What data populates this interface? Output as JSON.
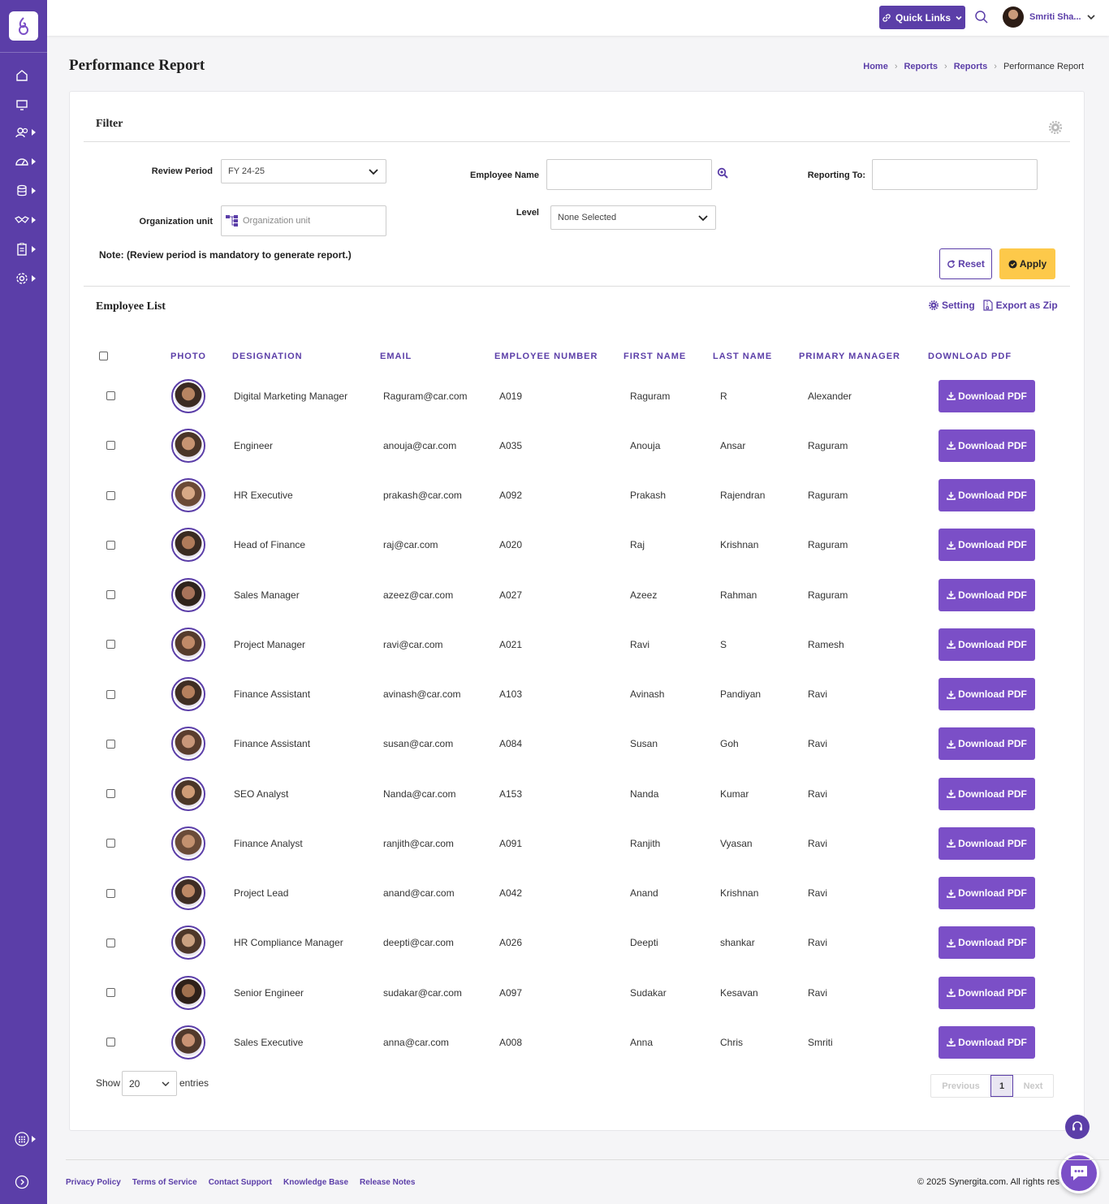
{
  "colors": {
    "brand": "#5b3ea8",
    "download": "#7b4fc7",
    "apply": "#fdc94a"
  },
  "topbar": {
    "quick_links": "Quick Links",
    "user_name": "Smriti Sha..."
  },
  "header": {
    "title": "Performance Report",
    "breadcrumb": [
      "Home",
      "Reports",
      "Reports",
      "Performance Report"
    ]
  },
  "filter": {
    "title": "Filter",
    "review_period_label": "Review Period",
    "review_period_value": "FY 24-25",
    "employee_name_label": "Employee Name",
    "employee_name_value": "",
    "reporting_to_label": "Reporting To:",
    "reporting_to_value": "",
    "org_unit_label": "Organization unit",
    "org_unit_placeholder": "Organization unit",
    "level_label": "Level",
    "level_value": "None Selected",
    "note": "Note: (Review period is mandatory to generate report.)",
    "reset": "Reset",
    "apply": "Apply"
  },
  "employee_list": {
    "title": "Employee List",
    "setting": "Setting",
    "export": "Export as Zip",
    "columns": [
      "PHOTO",
      "DESIGNATION",
      "EMAIL",
      "EMPLOYEE NUMBER",
      "FIRST NAME",
      "LAST NAME",
      "PRIMARY MANAGER",
      "DOWNLOAD PDF"
    ],
    "download_label": "Download PDF",
    "rows": [
      {
        "designation": "Digital Marketing Manager",
        "email": "Raguram@car.com",
        "number": "A019",
        "first": "Raguram",
        "last": "R",
        "manager": "Alexander"
      },
      {
        "designation": "Engineer",
        "email": "anouja@car.com",
        "number": "A035",
        "first": "Anouja",
        "last": "Ansar",
        "manager": "Raguram"
      },
      {
        "designation": "HR Executive",
        "email": "prakash@car.com",
        "number": "A092",
        "first": "Prakash",
        "last": "Rajendran",
        "manager": "Raguram"
      },
      {
        "designation": "Head of Finance",
        "email": "raj@car.com",
        "number": "A020",
        "first": "Raj",
        "last": "Krishnan",
        "manager": "Raguram"
      },
      {
        "designation": "Sales Manager",
        "email": "azeez@car.com",
        "number": "A027",
        "first": "Azeez",
        "last": "Rahman",
        "manager": "Raguram"
      },
      {
        "designation": "Project Manager",
        "email": "ravi@car.com",
        "number": "A021",
        "first": "Ravi",
        "last": "S",
        "manager": "Ramesh"
      },
      {
        "designation": "Finance Assistant",
        "email": "avinash@car.com",
        "number": "A103",
        "first": "Avinash",
        "last": "Pandiyan",
        "manager": "Ravi"
      },
      {
        "designation": "Finance Assistant",
        "email": "susan@car.com",
        "number": "A084",
        "first": "Susan",
        "last": "Goh",
        "manager": "Ravi"
      },
      {
        "designation": "SEO Analyst",
        "email": "Nanda@car.com",
        "number": "A153",
        "first": "Nanda",
        "last": "Kumar",
        "manager": "Ravi"
      },
      {
        "designation": "Finance Analyst",
        "email": "ranjith@car.com",
        "number": "A091",
        "first": "Ranjith",
        "last": "Vyasan",
        "manager": "Ravi"
      },
      {
        "designation": "Project Lead",
        "email": "anand@car.com",
        "number": "A042",
        "first": "Anand",
        "last": "Krishnan",
        "manager": "Ravi"
      },
      {
        "designation": "HR Compliance Manager",
        "email": "deepti@car.com",
        "number": "A026",
        "first": "Deepti",
        "last": "shankar",
        "manager": "Ravi"
      },
      {
        "designation": "Senior Engineer",
        "email": "sudakar@car.com",
        "number": "A097",
        "first": "Sudakar",
        "last": "Kesavan",
        "manager": "Ravi"
      },
      {
        "designation": "Sales Executive",
        "email": "anna@car.com",
        "number": "A008",
        "first": "Anna",
        "last": "Chris",
        "manager": "Smriti"
      }
    ]
  },
  "pagination": {
    "show": "Show",
    "page_size": "20",
    "entries": "entries",
    "previous": "Previous",
    "current": "1",
    "next": "Next"
  },
  "footer": {
    "links": [
      "Privacy Policy",
      "Terms of Service",
      "Contact Support",
      "Knowledge Base",
      "Release Notes"
    ],
    "copyright": "© 2025 Synergita.com. All rights res"
  }
}
